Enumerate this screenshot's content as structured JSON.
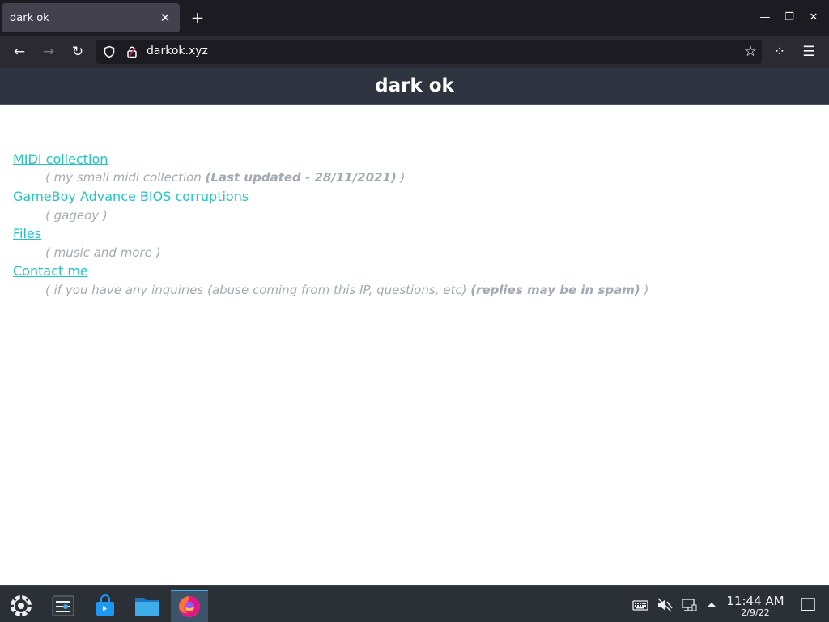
{
  "browser": {
    "tab": {
      "title": "dark ok",
      "close": "✕"
    },
    "new_tab": "+",
    "window_controls": {
      "minimize": "—",
      "restore": "❐",
      "close": "✕"
    },
    "nav": {
      "back": "←",
      "forward": "→",
      "reload": "↻",
      "bookmark": "☆",
      "extensions": "⁘",
      "menu": "☰"
    },
    "url": "darkok.xyz",
    "icons": [
      "shield-icon",
      "lock-icon",
      "star-icon",
      "extensions-icon",
      "hamburger-menu-icon"
    ]
  },
  "page": {
    "title": "dark ok",
    "entries": [
      {
        "link": "MIDI collection",
        "desc_prefix": "( my small midi collection ",
        "desc_bold": "(Last updated - 28/11/2021)",
        "desc_suffix": " )"
      },
      {
        "link": "GameBoy Advance BIOS corruptions",
        "desc_prefix": "( gageoy )",
        "desc_bold": "",
        "desc_suffix": ""
      },
      {
        "link": "Files",
        "desc_prefix": "( music and more )",
        "desc_bold": "",
        "desc_suffix": ""
      },
      {
        "link": "Contact me",
        "desc_prefix": "( if you have any inquiries (abuse coming from this IP, questions, etc) ",
        "desc_bold": "(replies may be in spam)",
        "desc_suffix": " )"
      }
    ],
    "colors": {
      "header_bg": "#2e3440",
      "link": "#1fc5c5",
      "desc": "#a3aab3"
    }
  },
  "taskbar": {
    "apps": [
      "app-launcher-icon",
      "system-settings-icon",
      "discover-store-icon",
      "file-manager-icon",
      "firefox-icon"
    ],
    "tray": [
      "keyboard-icon",
      "volume-muted-icon",
      "network-icon",
      "tray-expand-icon",
      "show-desktop-icon"
    ],
    "time": "11:44 AM",
    "date": "2/9/22"
  }
}
